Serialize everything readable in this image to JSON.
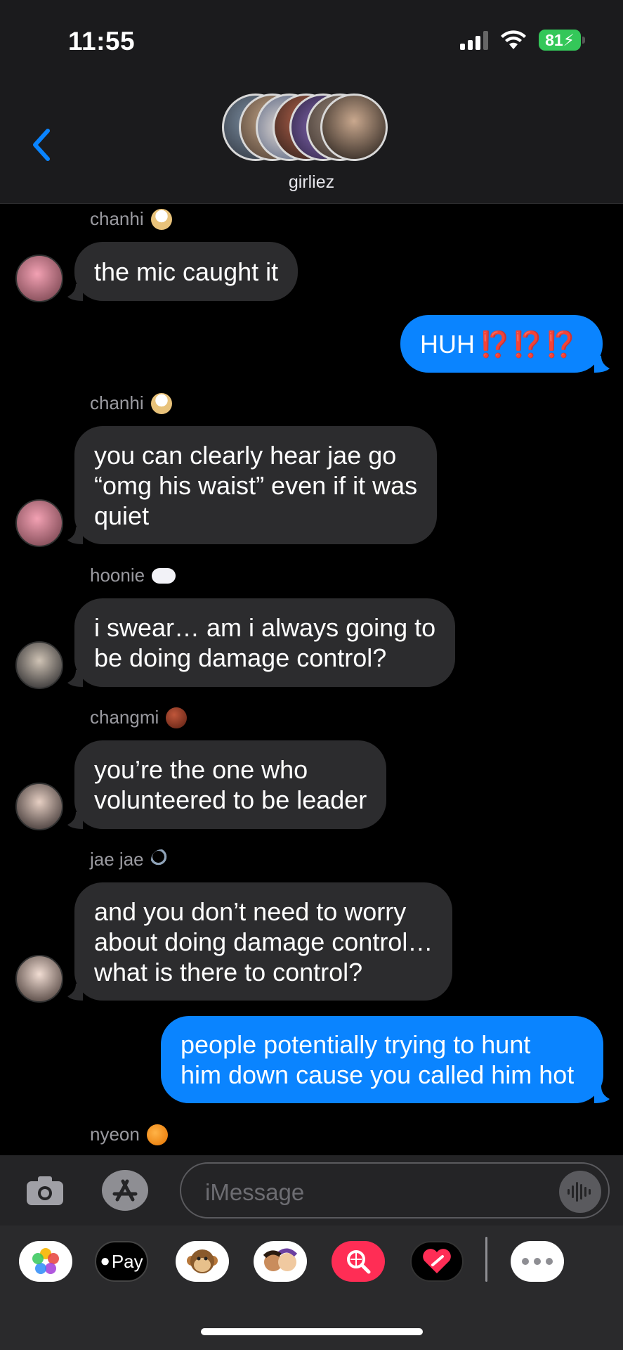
{
  "status": {
    "time": "11:55",
    "battery": "81"
  },
  "header": {
    "group_name": "girliez"
  },
  "messages": [
    {
      "sender": "chanhi",
      "text": "the mic caught it"
    },
    {
      "text": "HUH",
      "marks": "⁉️⁉️⁉️"
    },
    {
      "sender": "chanhi",
      "lines": [
        "you can clearly hear jae go",
        "“omg his waist” even if it was",
        "quiet"
      ]
    },
    {
      "sender": "hoonie",
      "lines": [
        "i swear… am i always going to",
        "be doing damage control?"
      ]
    },
    {
      "sender": "changmi",
      "lines": [
        "you’re the one who",
        "volunteered to be leader"
      ]
    },
    {
      "sender": "jae jae",
      "lines": [
        "and you don’t need to worry",
        "about doing damage control…",
        "what is there to control?"
      ]
    },
    {
      "lines": [
        "people potentially trying to hunt",
        "him down cause you called him hot"
      ]
    },
    {
      "sender": "nyeon"
    }
  ],
  "compose": {
    "placeholder": "iMessage"
  },
  "apps": {
    "pay_label": "Pay"
  },
  "colors": {
    "incoming": "#2c2c2e",
    "outgoing": "#0a84ff",
    "accent": "#0a84ff",
    "battery": "#34c759"
  }
}
